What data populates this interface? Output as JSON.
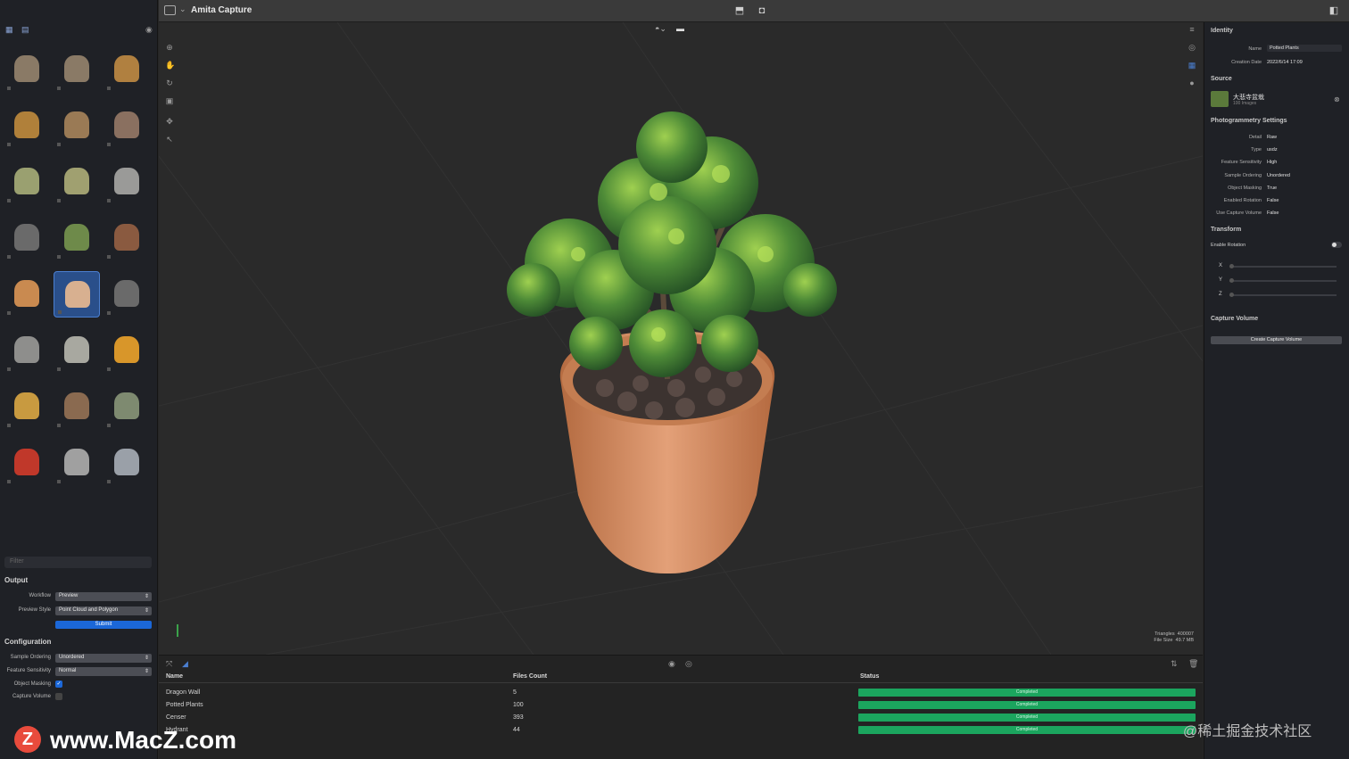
{
  "window": {
    "title": "Amita Capture"
  },
  "left": {
    "filter_placeholder": "Filter",
    "output": {
      "heading": "Output",
      "workflow_label": "Workflow",
      "workflow_value": "Preview",
      "preview_style_label": "Preview Style",
      "preview_style_value": "Point Cloud and Polygon",
      "submit_label": "Submit"
    },
    "configuration": {
      "heading": "Configuration",
      "sample_ordering_label": "Sample Ordering",
      "sample_ordering_value": "Unordered",
      "feature_sensitivity_label": "Feature Sensitivity",
      "feature_sensitivity_value": "Normal",
      "object_masking_label": "Object Masking",
      "object_masking_checked": true,
      "capture_volume_label": "Capture Volume",
      "capture_volume_checked": false
    },
    "thumbnail_count": 24,
    "selected_thumbnail": 13
  },
  "viewport": {
    "stats": {
      "triangles_label": "Triangles",
      "triangles_value": "400007",
      "file_size_label": "File Size",
      "file_size_value": "49.7 MB"
    }
  },
  "table": {
    "headers": [
      "Name",
      "Files Count",
      "Status"
    ],
    "rows": [
      {
        "name": "Dragon Wall",
        "files": "5",
        "status": "Completed"
      },
      {
        "name": "Potted Plants",
        "files": "100",
        "status": "Completed"
      },
      {
        "name": "Censer",
        "files": "393",
        "status": "Completed"
      },
      {
        "name": "Hydrant",
        "files": "44",
        "status": "Completed"
      }
    ]
  },
  "inspector": {
    "identity": {
      "heading": "Identity",
      "name_label": "Name",
      "name_value": "Potted Plants",
      "date_label": "Creation Date",
      "date_value": "2022/6/14 17:09"
    },
    "source": {
      "heading": "Source",
      "title": "大悲寺盆栽",
      "subtitle": "100 Images"
    },
    "photogrammetry": {
      "heading": "Photogrammetry Settings",
      "items": [
        {
          "label": "Detail",
          "value": "Raw"
        },
        {
          "label": "Type",
          "value": "usdz"
        },
        {
          "label": "Feature Sensitivity",
          "value": "High"
        },
        {
          "label": "Sample Ordering",
          "value": "Unordered"
        },
        {
          "label": "Object Masking",
          "value": "True"
        },
        {
          "label": "Enabled Rotation",
          "value": "False"
        },
        {
          "label": "Use Capture Volume",
          "value": "False"
        }
      ]
    },
    "transform": {
      "heading": "Transform",
      "enable_rotation_label": "Enable Rotation",
      "x": "X",
      "y": "Y",
      "z": "Z"
    },
    "capture_volume": {
      "heading": "Capture Volume",
      "button_label": "Create Capture Volume"
    }
  },
  "watermarks": {
    "left": "www.MacZ.com",
    "right": "@稀土掘金技术社区"
  },
  "colors": {
    "accent": "#1b67d8",
    "status_completed": "#1ba55e",
    "selection": "#2a4f8a"
  }
}
